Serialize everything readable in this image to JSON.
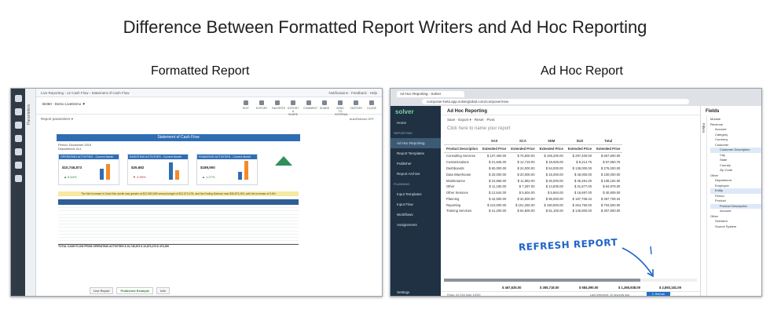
{
  "slide_title": "Difference Between Formatted Report Writers and Ad Hoc Reporting",
  "left_panel": {
    "heading": "Formatted Report",
    "topbar_breadcrumb": "Live Reporting › 12 Cash Flow › Statement of Cash Flow",
    "topbar_right": "Notifications · Feedback · Help",
    "report_name": "BI360 - Demo LiveDemo ▼",
    "tool_labels": [
      "EDIT",
      "EXPORT",
      "FAVORITE",
      "EXPORT & SHARE",
      "COMMENT",
      "SHARE",
      "SEND TO INTERNAL",
      "HISTORY",
      "CLOSE"
    ],
    "params_label": "Report parameters ▾",
    "parameters_strip": "Parameters",
    "autorefresh": "AutoRefresh OFF",
    "report_title": "Statement of Cash Flow",
    "meta": [
      "Period: December 2019",
      "Department: ALL"
    ],
    "cards": [
      {
        "title": "OPERATING ACTIVITIES - Current Month",
        "value": "$10,746,873",
        "change": "▲ 6.54%",
        "negative": false
      },
      {
        "title": "INVESTING ACTIVITIES - Current Month",
        "value": "$26,682",
        "change": "▼ 2.95%",
        "negative": true
      },
      {
        "title": "FINANCING ACTIVITIES - Current Month",
        "value": "$189,900",
        "change": "▲ 1.27%",
        "negative": false
      }
    ],
    "banner": "The Net Increase in Cash this month was greater at $12,963,659 versus budget of $12,672,478, and the Ending Balance was $36,873,493, with the increase of 5.6%",
    "table_total": "TOTAL CASH FLOW FROM OPERATING ACTIVITIES     $ 10,746,873     $ 10,873,473     $ 473,390",
    "sheet_tabs": [
      "Live Report",
      "Published Example",
      "Info"
    ]
  },
  "right_panel": {
    "heading": "Ad Hoc Report",
    "browser_tab": "Ad Hoc Reporting - Solver",
    "url": "composer-beta.app.solverglobal.com/composer/new",
    "app_title": "Ad Hoc Reporting",
    "toolbar": "Save  ·  Export ▾  ·  Reset  ·  Pivot",
    "report_name_placeholder": "Click here to name your report",
    "logo": "solver",
    "nav": {
      "home": "Home",
      "section_reporting": "REPORTING",
      "items": [
        "Ad Hoc Reporting",
        "Report Templates",
        "Publisher",
        "Report Archive"
      ],
      "section_planning": "PLANNING",
      "planning_items": [
        "Input Templates",
        "Input Flow",
        "Workflows",
        "Assignments"
      ],
      "settings": "Settings"
    },
    "grid": {
      "group_headers": [
        "SAS",
        "SCA",
        "SEM",
        "SUS",
        "Total"
      ],
      "col_headers": [
        "Product Description",
        "Extended Price",
        "Extended Price",
        "Extended Price",
        "Extended Price",
        "Extended Price"
      ],
      "rows": [
        [
          "Consulting Services",
          "$ 137,400.00",
          "$ 75,600.00",
          "$ 159,200.00",
          "$ 297,400.00",
          "$ 667,600.00"
        ],
        [
          "Customizations",
          "$ 21,846.00",
          "$ 12,715.00",
          "$ 18,925.00",
          "$ 8,214.75",
          "$ 67,650.75"
        ],
        [
          "Dashboards",
          "$ 60,000.00",
          "$ 24,000.00",
          "$ 54,000.00",
          "$ 138,000.00",
          "$ 276,000.00"
        ],
        [
          "Data Warehouse",
          "$ 20,000.00",
          "$ 20,000.00",
          "$ 15,000.00",
          "$ 45,000.00",
          "$ 100,000.00"
        ],
        [
          "Maintenance",
          "$ 24,665.00",
          "$ 11,962.00",
          "$ 26,000.00",
          "$ 45,491.00",
          "$ 108,184.00"
        ],
        [
          "Other",
          "$ 11,180.00",
          "$ 7,287.00",
          "$ 14,835.00",
          "$ 31,677.00",
          "$ 64,979.00"
        ],
        [
          "Other Services",
          "$ 12,644.00",
          "$ 5,604.00",
          "$ 5,864.00",
          "$ 16,697.00",
          "$ 40,809.00"
        ],
        [
          "Planning",
          "$ 42,500.00",
          "$ 32,500.00",
          "$ 95,000.00",
          "$ 187,708.34",
          "$ 357,708.34"
        ],
        [
          "Reporting",
          "$ 110,000.00",
          "$ 101,250.00",
          "$ 150,500.00",
          "$ 254,750.00",
          "$ 704,500.00"
        ],
        [
          "Training Services",
          "$ 41,200.00",
          "$ 64,800.00",
          "$ 61,100.00",
          "$ 140,800.00",
          "$ 307,900.00"
        ]
      ],
      "totals": [
        "$ 467,625.00",
        "$ 355,718.00",
        "$ 584,090.00",
        "$ 1,365,938.09",
        "$ 2,893,181.09"
      ]
    },
    "status": "Rows: 44    Grid total: 10000",
    "last_refreshed": "Last refreshed: 10 seconds ago",
    "refresh_button": "↻ Refresh",
    "fields_title": "Fields",
    "filters_label": "Filters",
    "fields_list": [
      "Module",
      "Revenue",
      "Account",
      "Category",
      "Currency",
      "Customer",
      "Customer Description",
      "City",
      "State",
      "Country",
      "Zip Code",
      "Other",
      "Department",
      "Employee",
      "Entity",
      "Period",
      "Product",
      "Product Description",
      "Account",
      "Other",
      "Scenario",
      "Source System"
    ]
  },
  "annotation": "REFRESH REPORT",
  "colors": {
    "report_blue": "#2e6db4",
    "sidebar_dark": "#1f3142",
    "annotation_blue": "#1e63c8"
  }
}
